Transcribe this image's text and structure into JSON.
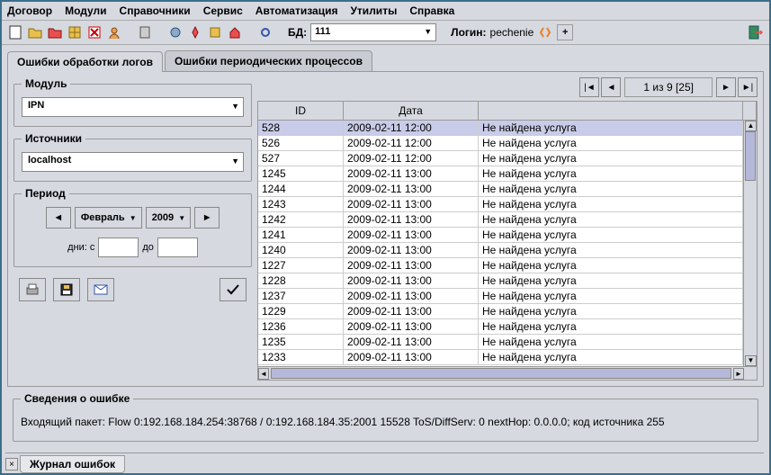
{
  "menu": [
    "Договор",
    "Модули",
    "Справочники",
    "Сервис",
    "Автоматизация",
    "Утилиты",
    "Справка"
  ],
  "toolbar": {
    "db_label": "БД:",
    "db_value": "111",
    "login_label": "Логин:",
    "login_value": "pechenie"
  },
  "tabs": {
    "t1": "Ошибки обработки логов",
    "t2": "Ошибки периодических процессов"
  },
  "filters": {
    "module_legend": "Модуль",
    "module_value": "IPN",
    "sources_legend": "Источники",
    "sources_value": "localhost",
    "period_legend": "Период",
    "month": "Февраль",
    "year": "2009",
    "days_from": "дни: с",
    "days_to": "до"
  },
  "pager": {
    "text": "1 из 9 [25]"
  },
  "grid": {
    "headers": {
      "c1": "ID",
      "c2": "Дата",
      "c3": ""
    },
    "rows": [
      {
        "id": "528",
        "date": "2009-02-11 12:00",
        "msg": "Не найдена услуга",
        "sel": true
      },
      {
        "id": "526",
        "date": "2009-02-11 12:00",
        "msg": "Не найдена услуга"
      },
      {
        "id": "527",
        "date": "2009-02-11 12:00",
        "msg": "Не найдена услуга"
      },
      {
        "id": "1245",
        "date": "2009-02-11 13:00",
        "msg": "Не найдена услуга"
      },
      {
        "id": "1244",
        "date": "2009-02-11 13:00",
        "msg": "Не найдена услуга"
      },
      {
        "id": "1243",
        "date": "2009-02-11 13:00",
        "msg": "Не найдена услуга"
      },
      {
        "id": "1242",
        "date": "2009-02-11 13:00",
        "msg": "Не найдена услуга"
      },
      {
        "id": "1241",
        "date": "2009-02-11 13:00",
        "msg": "Не найдена услуга"
      },
      {
        "id": "1240",
        "date": "2009-02-11 13:00",
        "msg": "Не найдена услуга"
      },
      {
        "id": "1227",
        "date": "2009-02-11 13:00",
        "msg": "Не найдена услуга"
      },
      {
        "id": "1228",
        "date": "2009-02-11 13:00",
        "msg": "Не найдена услуга"
      },
      {
        "id": "1237",
        "date": "2009-02-11 13:00",
        "msg": "Не найдена услуга"
      },
      {
        "id": "1229",
        "date": "2009-02-11 13:00",
        "msg": "Не найдена услуга"
      },
      {
        "id": "1236",
        "date": "2009-02-11 13:00",
        "msg": "Не найдена услуга"
      },
      {
        "id": "1235",
        "date": "2009-02-11 13:00",
        "msg": "Не найдена услуга"
      },
      {
        "id": "1233",
        "date": "2009-02-11 13:00",
        "msg": "Не найдена услуга"
      }
    ]
  },
  "error_detail": {
    "legend": "Сведения о ошибке",
    "text": "Входящий пакет: Flow 0:192.168.184.254:38768 / 0:192.168.184.35:2001 15528 ToS/DiffServ: 0 nextHop: 0.0.0.0; код источника 255"
  },
  "bottom_tab": "Журнал ошибок"
}
